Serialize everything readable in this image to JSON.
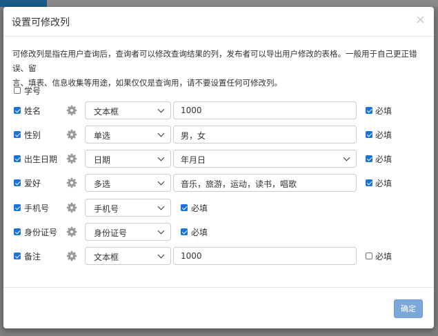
{
  "modal": {
    "title": "设置可修改列",
    "close_glyph": "×",
    "description_line1": "可修改列是指在用户查询后，查询者可以修改查询结果的列，发布者可以导出用户修改的表格。一般用于自己更正错误、留",
    "description_line2": "言、填表、信息收集等用途，如果仅仅是查询用，请不要设置任何可修改列。",
    "ok_label": "确定"
  },
  "fields": [
    {
      "label": "学号",
      "checked": false
    },
    {
      "label": "姓名",
      "checked": true,
      "type": "文本框",
      "value": "1000",
      "required_label": "必填",
      "required": true
    },
    {
      "label": "性别",
      "checked": true,
      "type": "单选",
      "value": "男，女",
      "required_label": "必填",
      "required": true
    },
    {
      "label": "出生日期",
      "checked": true,
      "type": "日期",
      "value": "年月日",
      "required_label": "必填",
      "required": true
    },
    {
      "label": "爱好",
      "checked": true,
      "type": "多选",
      "value": "音乐，旅游，运动，读书，唱歌",
      "required_label": "必填",
      "required": true
    },
    {
      "label": "手机号",
      "checked": true,
      "type": "手机号",
      "required_label": "必填",
      "required": true
    },
    {
      "label": "身份证号",
      "checked": true,
      "type": "身份证号",
      "required_label": "必填",
      "required": true
    },
    {
      "label": "备注",
      "checked": true,
      "type": "文本框",
      "value": "1000",
      "required_label": "必填",
      "required": false
    }
  ],
  "icons": {
    "settings": "gear-icon",
    "dropdown": "chevron-down-icon",
    "close": "close-icon"
  },
  "colors": {
    "checkbox_checked": "#1a73d6",
    "ok_button": "#7aa8da",
    "header_accent": "#1b5b86"
  }
}
